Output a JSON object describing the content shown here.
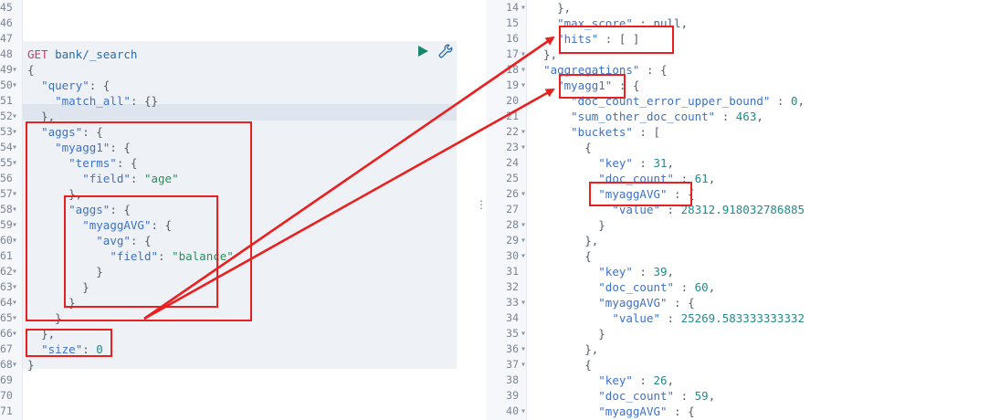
{
  "left_pane": {
    "lines": [
      {
        "num": "45",
        "text": ""
      },
      {
        "num": "46",
        "text": ""
      },
      {
        "num": "47",
        "text": ""
      },
      {
        "num": "48",
        "method": "GET",
        "path": " bank/_search"
      },
      {
        "num": "49",
        "text": "{",
        "fold": true
      },
      {
        "num": "50",
        "key": "\"query\"",
        "rest": ": {",
        "indent": "  ",
        "fold": true
      },
      {
        "num": "51",
        "key": "\"match_all\"",
        "rest": ": {}",
        "indent": "    "
      },
      {
        "num": "52",
        "text": "  },",
        "fold": true
      },
      {
        "num": "53",
        "key": "\"aggs\"",
        "rest": ": {",
        "indent": "  ",
        "fold": true
      },
      {
        "num": "54",
        "key": "\"myagg1\"",
        "rest": ": {",
        "indent": "    ",
        "fold": true
      },
      {
        "num": "55",
        "key": "\"terms\"",
        "rest": ": {",
        "indent": "      ",
        "fold": true
      },
      {
        "num": "56",
        "key": "\"field\"",
        "rest": ": ",
        "value": "\"age\"",
        "indent": "        "
      },
      {
        "num": "57",
        "text": "      },",
        "fold": true
      },
      {
        "num": "58",
        "key": "\"aggs\"",
        "rest": ": {",
        "indent": "      ",
        "fold": true
      },
      {
        "num": "59",
        "key": "\"myaggAVG\"",
        "rest": ": {",
        "indent": "        ",
        "fold": true
      },
      {
        "num": "60",
        "key": "\"avg\"",
        "rest": ": {",
        "indent": "          ",
        "fold": true
      },
      {
        "num": "61",
        "key": "\"field\"",
        "rest": ": ",
        "value": "\"balance\"",
        "indent": "            "
      },
      {
        "num": "62",
        "text": "          }",
        "fold": true
      },
      {
        "num": "63",
        "text": "        }",
        "fold": true
      },
      {
        "num": "64",
        "text": "      }",
        "fold": true
      },
      {
        "num": "65",
        "text": "    }",
        "fold": true
      },
      {
        "num": "66",
        "text": "  },",
        "fold": true
      },
      {
        "num": "67",
        "key": "\"size\"",
        "rest": ": ",
        "number": "0",
        "indent": "  "
      },
      {
        "num": "68",
        "text": "}",
        "fold": true
      },
      {
        "num": "69",
        "text": ""
      },
      {
        "num": "70",
        "text": ""
      },
      {
        "num": "71",
        "text": ""
      }
    ]
  },
  "right_pane": {
    "lines": [
      {
        "num": "14",
        "text": "    },",
        "fold": true
      },
      {
        "num": "15",
        "key": "\"max_score\"",
        "rest": " : ",
        "value": "null",
        "indent": "    ",
        "suffix": ","
      },
      {
        "num": "16",
        "key": "\"hits\"",
        "rest": " : [ ]",
        "indent": "    "
      },
      {
        "num": "17",
        "text": "  },",
        "fold": true
      },
      {
        "num": "18",
        "key": "\"aggregations\"",
        "rest": " : {",
        "indent": "  ",
        "fold": true
      },
      {
        "num": "19",
        "key": "\"myagg1\"",
        "rest": " : {",
        "indent": "    ",
        "fold": true
      },
      {
        "num": "20",
        "key": "\"doc_count_error_upper_bound\"",
        "rest": " : ",
        "number": "0",
        "suffix": ",",
        "indent": "      "
      },
      {
        "num": "21",
        "key": "\"sum_other_doc_count\"",
        "rest": " : ",
        "number": "463",
        "suffix": ",",
        "indent": "      "
      },
      {
        "num": "22",
        "key": "\"buckets\"",
        "rest": " : [",
        "indent": "      ",
        "fold": true
      },
      {
        "num": "23",
        "text": "        {",
        "fold": true
      },
      {
        "num": "24",
        "key": "\"key\"",
        "rest": " : ",
        "number": "31",
        "suffix": ",",
        "indent": "          "
      },
      {
        "num": "25",
        "key": "\"doc_count\"",
        "rest": " : ",
        "number": "61",
        "suffix": ",",
        "indent": "          "
      },
      {
        "num": "26",
        "key": "\"myaggAVG\"",
        "rest": " : {",
        "indent": "          ",
        "fold": true
      },
      {
        "num": "27",
        "key": "\"value\"",
        "rest": " : ",
        "number": "28312.918032786885",
        "indent": "            "
      },
      {
        "num": "28",
        "text": "          }",
        "fold": true
      },
      {
        "num": "29",
        "text": "        },",
        "fold": true
      },
      {
        "num": "30",
        "text": "        {",
        "fold": true
      },
      {
        "num": "31",
        "key": "\"key\"",
        "rest": " : ",
        "number": "39",
        "suffix": ",",
        "indent": "          "
      },
      {
        "num": "32",
        "key": "\"doc_count\"",
        "rest": " : ",
        "number": "60",
        "suffix": ",",
        "indent": "          "
      },
      {
        "num": "33",
        "key": "\"myaggAVG\"",
        "rest": " : {",
        "indent": "          ",
        "fold": true
      },
      {
        "num": "34",
        "key": "\"value\"",
        "rest": " : ",
        "number": "25269.583333333332",
        "indent": "            "
      },
      {
        "num": "35",
        "text": "          }",
        "fold": true
      },
      {
        "num": "36",
        "text": "        },",
        "fold": true
      },
      {
        "num": "37",
        "text": "        {",
        "fold": true
      },
      {
        "num": "38",
        "key": "\"key\"",
        "rest": " : ",
        "number": "26",
        "suffix": ",",
        "indent": "          "
      },
      {
        "num": "39",
        "key": "\"doc_count\"",
        "rest": " : ",
        "number": "59",
        "suffix": ",",
        "indent": "          "
      },
      {
        "num": "40",
        "key": "\"myaggAVG\"",
        "rest": " : {",
        "indent": "          ",
        "fold": true
      }
    ]
  },
  "splitter_glyph": "⋮",
  "colors": {
    "highlight_box": "#ea1f1f",
    "arrow": "#ea1f1f",
    "keyword": "#c93b69",
    "key": "#3d71c9",
    "string": "#2d8c5a",
    "number": "#248a8a"
  },
  "icons": {
    "run": "play-icon",
    "settings": "wrench-icon"
  }
}
